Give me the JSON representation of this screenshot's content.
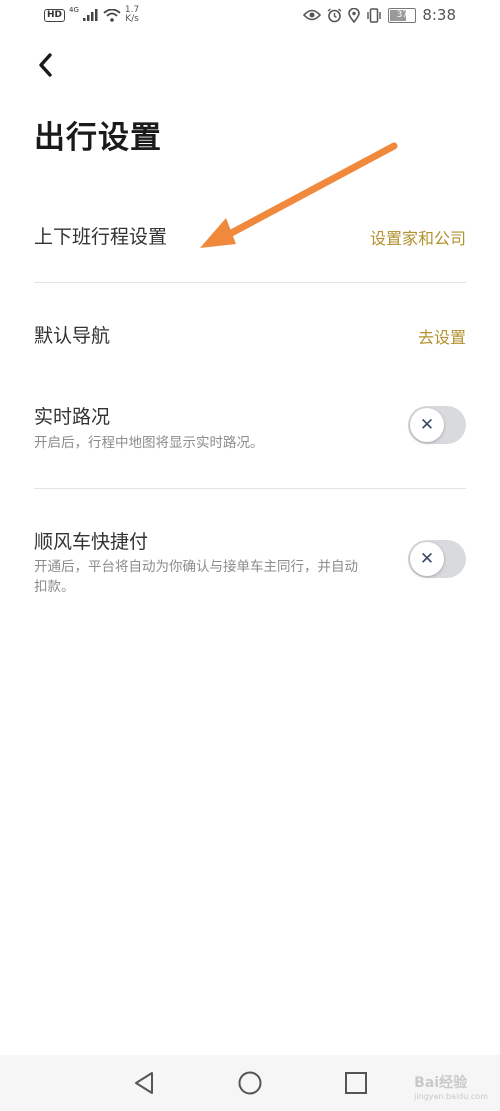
{
  "status_bar": {
    "hd": "HD",
    "network": "4G",
    "speed_value": "1.7",
    "speed_unit": "K/s",
    "battery": "37",
    "time": "8:38"
  },
  "page": {
    "title": "出行设置"
  },
  "settings": {
    "commute": {
      "label": "上下班行程设置",
      "action": "设置家和公司"
    },
    "navigation": {
      "label": "默认导航",
      "action": "去设置"
    },
    "traffic": {
      "label": "实时路况",
      "desc": "开启后，行程中地图将显示实时路况。",
      "enabled": false
    },
    "quickpay": {
      "label": "顺风车快捷付",
      "desc": "开通后，平台将自动为你确认与接单车主同行，并自动扣款。",
      "enabled": false
    }
  },
  "toggle_off_glyph": "✕",
  "watermark": {
    "brand": "Bai经验",
    "url": "jingyan.baidu.com"
  },
  "colors": {
    "accent": "#b3912f",
    "arrow": "#f0893c",
    "toggle_off": "#d9dade"
  },
  "icons": [
    "back-arrow-icon",
    "eye-icon",
    "alarm-icon",
    "location-icon",
    "vibrate-icon",
    "nav-back-icon",
    "nav-home-icon",
    "nav-recents-icon"
  ]
}
